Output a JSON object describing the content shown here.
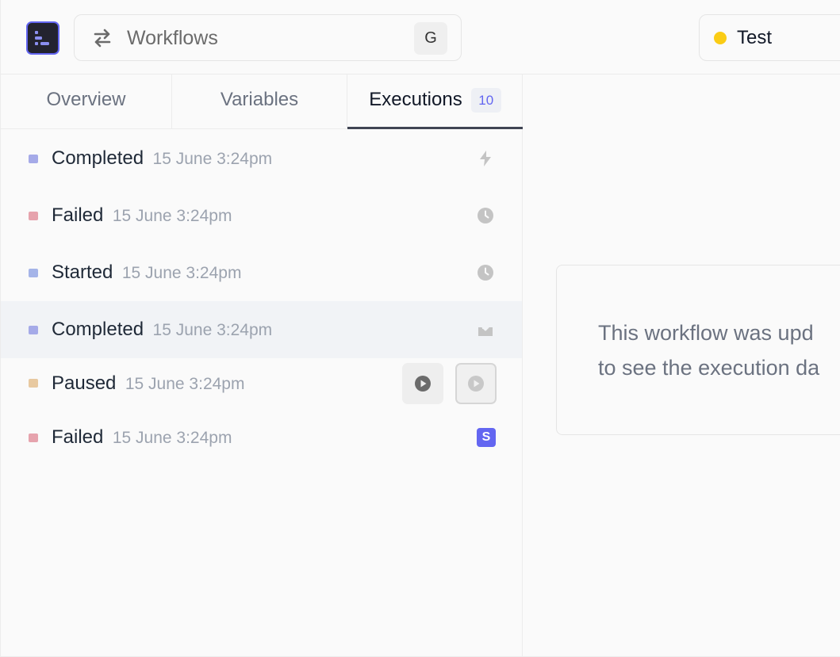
{
  "header": {
    "search_label": "Workflows",
    "search_shortcut": "G",
    "environment": {
      "label": "Test",
      "dot_color": "#facc15"
    }
  },
  "tabs": [
    {
      "label": "Overview"
    },
    {
      "label": "Variables"
    },
    {
      "label": "Executions",
      "badge": "10",
      "active": true
    }
  ],
  "executions": [
    {
      "status": "Completed",
      "time": "15 June 3:24pm",
      "color": "#a5aae8",
      "icon": "bolt-icon"
    },
    {
      "status": "Failed",
      "time": "15 June 3:24pm",
      "color": "#e6a3ad",
      "icon": "clock-icon"
    },
    {
      "status": "Started",
      "time": "15 June 3:24pm",
      "color": "#a5b4e8",
      "icon": "clock-icon"
    },
    {
      "status": "Completed",
      "time": "15 June 3:24pm",
      "color": "#a5aae8",
      "icon": "inbox-download-icon",
      "selected": true
    },
    {
      "status": "Paused",
      "time": "15 June 3:24pm",
      "color": "#e8c9a0",
      "icon": "play-icon"
    },
    {
      "status": "Failed",
      "time": "15 June 3:24pm",
      "color": "#e6a3ad",
      "icon": "s-badge-icon",
      "icon_text": "S"
    }
  ],
  "notice": {
    "line1": "This workflow was upd",
    "line2": "to see the execution da"
  },
  "colors": {
    "accent": "#6366f1",
    "logo_bg": "#23232f"
  }
}
